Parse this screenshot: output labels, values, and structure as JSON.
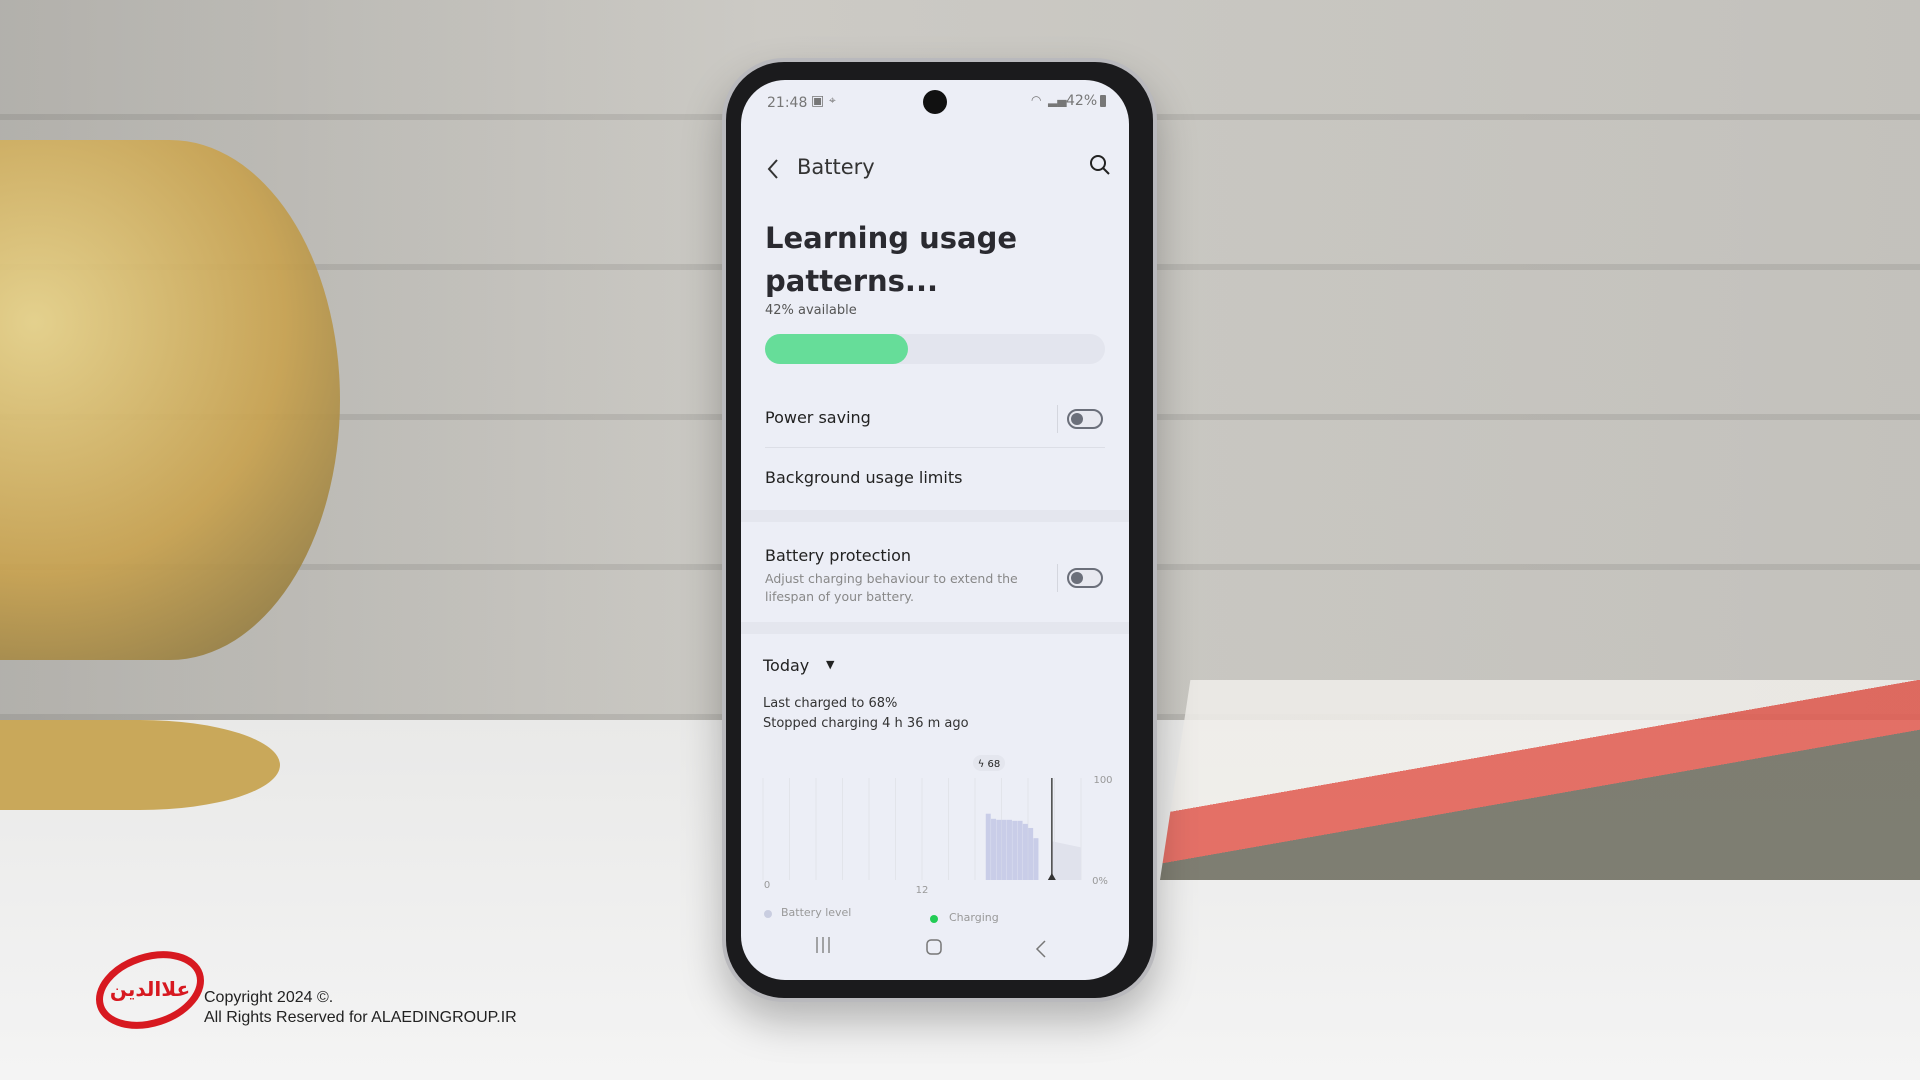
{
  "status_bar": {
    "time": "21:48",
    "battery": "42%",
    "icons": [
      "gallery-icon",
      "location-icon",
      "wifi-icon",
      "signal-icon",
      "battery-icon"
    ]
  },
  "header": {
    "title": "Battery",
    "back_icon": "chevron-left-icon",
    "search_icon": "search-icon"
  },
  "summary": {
    "title_line1": "Learning usage",
    "title_line2": "patterns...",
    "available": "42% available",
    "level_percent": 42,
    "bar_color": "#66dd99"
  },
  "settings": [
    {
      "label": "Power saving",
      "toggle": false
    },
    {
      "label": "Background usage limits"
    },
    {
      "label": "Battery protection",
      "description_line1": "Adjust charging behaviour to extend the",
      "description_line2": "lifespan of your battery.",
      "toggle": false
    }
  ],
  "usage": {
    "period": "Today",
    "last_charged": "Last charged to 68%",
    "stopped": "Stopped charging 4 h 36 m ago"
  },
  "chart_data": {
    "type": "bar",
    "xlim": [
      0,
      24
    ],
    "ylim": [
      0,
      100
    ],
    "x_ticks": [
      "0",
      "12"
    ],
    "y_ticks": [
      "100",
      "0%"
    ],
    "x": [
      17.0,
      17.4,
      17.8,
      18.2,
      18.6,
      19.0,
      19.4,
      19.8,
      20.2,
      20.6
    ],
    "values": [
      65,
      60,
      59,
      59,
      59,
      58,
      58,
      55,
      51,
      41
    ],
    "current_time": 21.8,
    "predicted": {
      "x": [
        21.8,
        24
      ],
      "values": [
        38,
        32
      ]
    },
    "charge_badge": "68",
    "legend": [
      {
        "name": "Battery level",
        "color": "#c9cde0"
      },
      {
        "name": "Charging",
        "color": "#22cc55"
      }
    ],
    "bar_color": "#c9cde8"
  },
  "nav": {
    "icons": [
      "recents-icon",
      "home-icon",
      "back-icon"
    ]
  },
  "watermark": {
    "logo_text": "علاالدین",
    "line1": "Copyright 2024 ©.",
    "line2": "All Rights Reserved for ALAEDINGROUP.IR"
  }
}
